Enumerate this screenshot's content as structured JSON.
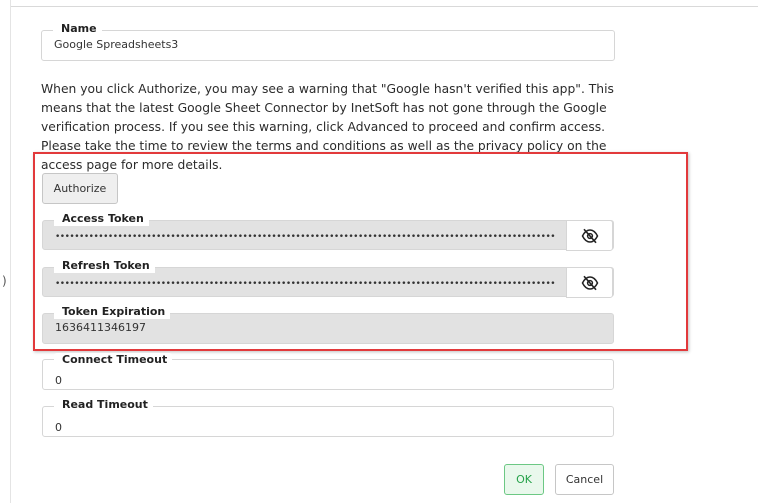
{
  "fields": {
    "name": {
      "label": "Name",
      "value": "Google Spreadsheets3"
    },
    "access_token": {
      "label": "Access Token",
      "masked_value": "••••••••••••••••••••••••••••••••••••••••••••••••••••••••••••••••••••••••••••••••••••••••••••••••••••••••"
    },
    "refresh_token": {
      "label": "Refresh Token",
      "masked_value": "••••••••••••••••••••••••••••••••••••••••••••••••••••••••••••••••••••••••••••••••••••••••••••••••••••••••"
    },
    "token_expiration": {
      "label": "Token Expiration",
      "value": "1636411346197"
    },
    "connect_timeout": {
      "label": "Connect Timeout",
      "value": "0"
    },
    "read_timeout": {
      "label": "Read Timeout",
      "value": "0"
    }
  },
  "description": "When you click Authorize, you may see a warning that \"Google hasn't verified this app\". This means that the latest Google Sheet Connector by InetSoft has not gone through the Google verification process. If you see this warning, click Advanced to proceed and confirm access. Please take the time to review the terms and conditions as well as the privacy policy on the access page for more details.",
  "buttons": {
    "authorize": "Authorize",
    "ok": "OK",
    "cancel": "Cancel"
  },
  "stray_text": ")",
  "icons": {
    "access_token_toggle": "eye-slash-icon",
    "refresh_token_toggle": "eye-slash-icon"
  },
  "colors": {
    "highlight_border": "#e2393b",
    "ok_text": "#27a24a",
    "ok_border": "#6cc884",
    "readonly_field_bg": "#e2e2e2"
  }
}
